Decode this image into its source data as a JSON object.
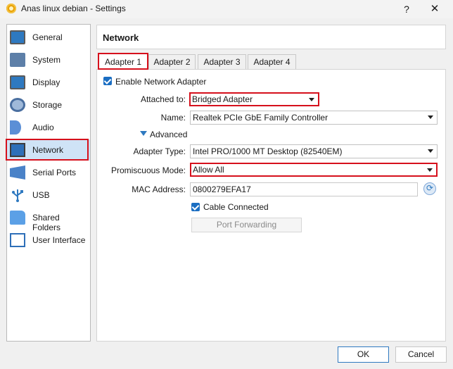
{
  "window": {
    "title": "Anas linux debian - Settings",
    "help": "?",
    "close": "✕"
  },
  "sidebar": {
    "items": [
      {
        "label": "General",
        "icon": "general-monitor-icon"
      },
      {
        "label": "System",
        "icon": "system-chip-icon"
      },
      {
        "label": "Display",
        "icon": "display-monitor-icon"
      },
      {
        "label": "Storage",
        "icon": "storage-disc-icon"
      },
      {
        "label": "Audio",
        "icon": "audio-speaker-icon"
      },
      {
        "label": "Network",
        "icon": "network-icon",
        "selected": true
      },
      {
        "label": "Serial Ports",
        "icon": "serial-port-icon"
      },
      {
        "label": "USB",
        "icon": "usb-icon"
      },
      {
        "label": "Shared Folders",
        "icon": "folder-icon"
      },
      {
        "label": "User Interface",
        "icon": "user-interface-icon"
      }
    ]
  },
  "page": {
    "title": "Network"
  },
  "tabs": [
    {
      "label": "Adapter 1",
      "active": true
    },
    {
      "label": "Adapter 2"
    },
    {
      "label": "Adapter 3"
    },
    {
      "label": "Adapter 4"
    }
  ],
  "form": {
    "enable_label": "Enable Network Adapter",
    "enable_checked": true,
    "attached_label": "Attached to:",
    "attached_value": "Bridged Adapter",
    "name_label": "Name:",
    "name_value": "Realtek PCIe GbE Family Controller",
    "advanced_label": "Advanced",
    "adapter_type_label": "Adapter Type:",
    "adapter_type_value": "Intel PRO/1000 MT Desktop (82540EM)",
    "promiscuous_label": "Promiscuous Mode:",
    "promiscuous_value": "Allow All",
    "mac_label": "MAC Address:",
    "mac_value": "0800279EFA17",
    "cable_label": "Cable Connected",
    "cable_checked": true,
    "port_forwarding_label": "Port Forwarding"
  },
  "buttons": {
    "ok": "OK",
    "cancel": "Cancel"
  },
  "colors": {
    "highlight": "#d6101c",
    "accent": "#1b6ec2",
    "selection": "#cfe3f6"
  }
}
